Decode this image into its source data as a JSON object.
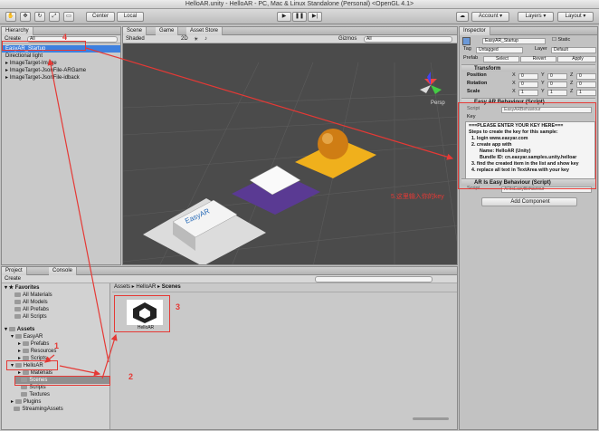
{
  "window": {
    "title": "HelloAR.unity - HelloAR - PC, Mac & Linux Standalone (Personal) <OpenGL 4.1>"
  },
  "toolbar": {
    "center": "Center",
    "local": "Local",
    "account": "Account",
    "layers": "Layers",
    "layout": "Layout"
  },
  "hierarchy": {
    "tab": "Hierarchy",
    "create": "Create",
    "search": "All",
    "items": [
      "EasyAR_Startup",
      "Directional light",
      "ImageTarget-Image",
      "ImageTarget-JsonFile-ARGame",
      "ImageTarget-JsonFile-idback"
    ]
  },
  "scene": {
    "tabs": [
      "Scene",
      "Game",
      "Asset Store"
    ],
    "shading": "Shaded",
    "mode2d": "2D",
    "gizmos": "Gizmos",
    "search": "All",
    "persp": "Persp",
    "logo_text": "EasyAR"
  },
  "inspector": {
    "tab": "Inspector",
    "object_name": "EasyAR_Startup",
    "static": "Static",
    "tag_label": "Tag",
    "tag_value": "Untagged",
    "layer_label": "Layer",
    "layer_value": "Default",
    "prefab_label": "Prefab",
    "prefab_buttons": [
      "Select",
      "Revert",
      "Apply"
    ],
    "transform": {
      "title": "Transform",
      "rows": [
        {
          "label": "Position",
          "x": "0",
          "y": "0",
          "z": "0"
        },
        {
          "label": "Rotation",
          "x": "0",
          "y": "0",
          "z": "0"
        },
        {
          "label": "Scale",
          "x": "1",
          "y": "1",
          "z": "1"
        }
      ]
    },
    "behaviour": {
      "title": "Easy AR Behaviour (Script)",
      "script_label": "Script",
      "script_value": "EasyARBehaviour",
      "key_label": "Key",
      "key_text": [
        "===PLEASE ENTER YOUR KEY HERE===",
        "Steps to create the key for this sample:",
        "1. login www.easyar.com",
        "2. create app with",
        "Name: HelloAR (Unity)",
        "Bundle ID: cn.easyar.samples.unity.helloar",
        "3. find the created item in the list and show key",
        "4. replace all text in TextArea with your key"
      ]
    },
    "ar_behaviour": {
      "title": "AR Is Easy Behaviour (Script)",
      "script_label": "Script",
      "script_value": "ARIsEasyBehaviour"
    },
    "add_component": "Add Component"
  },
  "project": {
    "tabs": [
      "Project",
      "Console"
    ],
    "create": "Create",
    "favorites": {
      "label": "Favorites",
      "items": [
        "All Materials",
        "All Models",
        "All Prefabs",
        "All Scripts"
      ]
    },
    "assets": {
      "label": "Assets",
      "easyar": "EasyAR",
      "easyar_children": [
        "Prefabs",
        "Resources",
        "Scripts"
      ],
      "helloar": "HelloAR",
      "helloar_children": [
        "Materials",
        "Scenes",
        "Scripts",
        "Textures"
      ],
      "plugins": "Plugins",
      "streaming": "StreamingAssets"
    },
    "breadcrumb": [
      "Assets",
      "HelloAR",
      "Scenes"
    ],
    "file_name": "HelloAR"
  },
  "annotations": {
    "n1": "1",
    "n2": "2",
    "n3": "3",
    "n4": "4",
    "n5": "5.这里输入你的key"
  },
  "colors": {
    "annotation": "#e53935",
    "selection": "#3d80df",
    "scene_bg": "#4b4b4b"
  }
}
